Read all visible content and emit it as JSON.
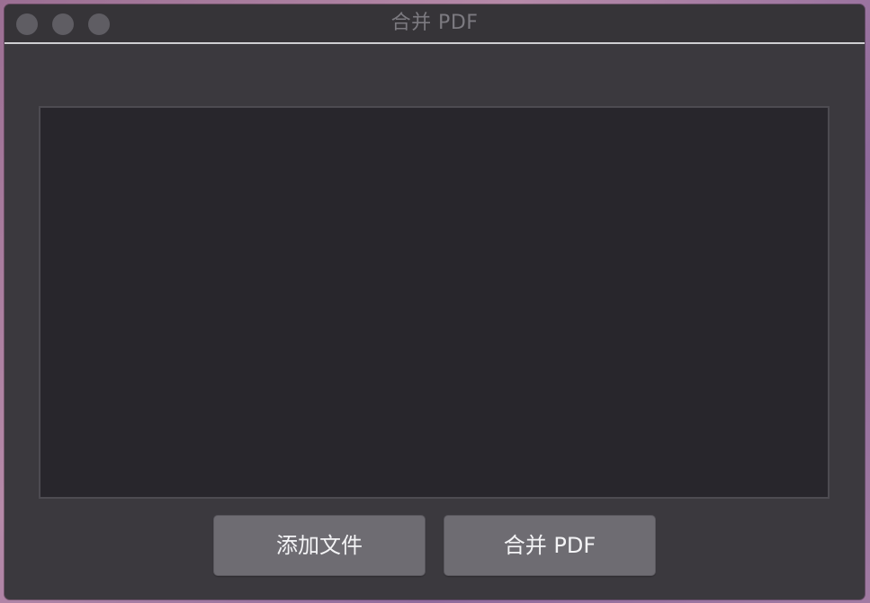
{
  "window": {
    "title": "合并 PDF"
  },
  "buttons": {
    "add_files": "添加文件",
    "merge_pdf": "合并 PDF"
  },
  "colors": {
    "window_bg": "#3b393e",
    "titlebar_bg": "#363438",
    "list_bg": "#28262c",
    "button_bg": "#6e6c72",
    "traffic_light": "#5f5d63"
  },
  "file_list": {
    "items": []
  }
}
